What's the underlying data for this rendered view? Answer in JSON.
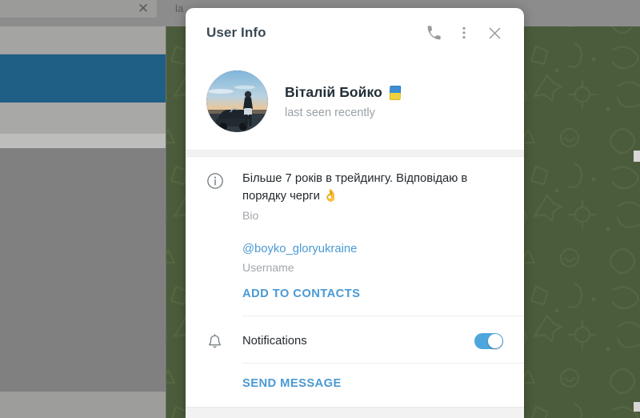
{
  "window": {
    "close_icon": "close-icon",
    "partial_label": "la"
  },
  "panel": {
    "title": "User Info",
    "header_actions": [
      {
        "name": "call-button",
        "icon": "phone-icon"
      },
      {
        "name": "more-menu-button",
        "icon": "vertical-dots-icon"
      },
      {
        "name": "close-panel-button",
        "icon": "close-icon"
      }
    ],
    "profile": {
      "avatar_alt": "user-avatar-photo",
      "name": "Віталій Бойко",
      "name_emoji": "🇺🇦",
      "status": "last seen recently"
    },
    "bio": {
      "icon": "info-circle-icon",
      "value": "Більше 7 років в трейдингу. Відповідаю в порядку черги 👌",
      "label": "Bio"
    },
    "username": {
      "value": "@boyko_gloryukraine",
      "label": "Username"
    },
    "add_to_contacts_label": "ADD TO CONTACTS",
    "notifications": {
      "icon": "bell-icon",
      "label": "Notifications",
      "enabled": true
    },
    "send_message_label": "SEND MESSAGE"
  },
  "colors": {
    "accent_link": "#4a9ad4",
    "toggle_on": "#4fa6de",
    "title_text": "#3b4a54",
    "muted_text": "#a1a7ab",
    "wallpaper_green": "#4b5c3c",
    "sidebar_selected_blue": "#1f5e85",
    "dim_overlay_grey": "#8c8c8c"
  }
}
